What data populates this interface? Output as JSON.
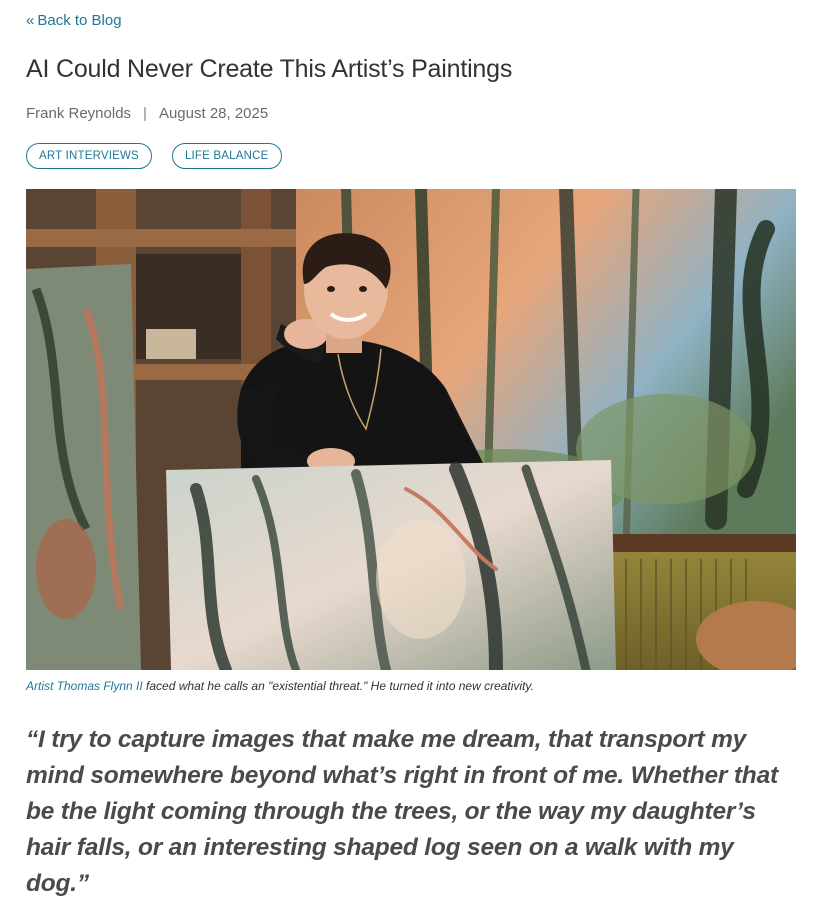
{
  "nav": {
    "back_label": "Back to Blog"
  },
  "article": {
    "title": "AI Could Never Create This Artist’s Paintings",
    "author": "Frank Reynolds",
    "separator": "|",
    "date": "August 28, 2025",
    "tags": [
      "ART INTERVIEWS",
      "LIFE BALANCE"
    ]
  },
  "caption": {
    "link_text": "Artist Thomas Flynn II",
    "text": " faced what he calls an \"existential threat.\" He turned it into new creativity."
  },
  "quote": "“I try to capture images that make me dream, that transport my mind somewhere beyond what’s right in front of me. Whether that be the light coming through the trees, or the way my daughter’s hair falls, or an interesting shaped log seen on a walk with my dog.”",
  "colors": {
    "accent": "#1f7896",
    "text": "#333333",
    "muted": "#6a6a6a"
  },
  "icons": {
    "back": "double-chevron-left-icon"
  }
}
